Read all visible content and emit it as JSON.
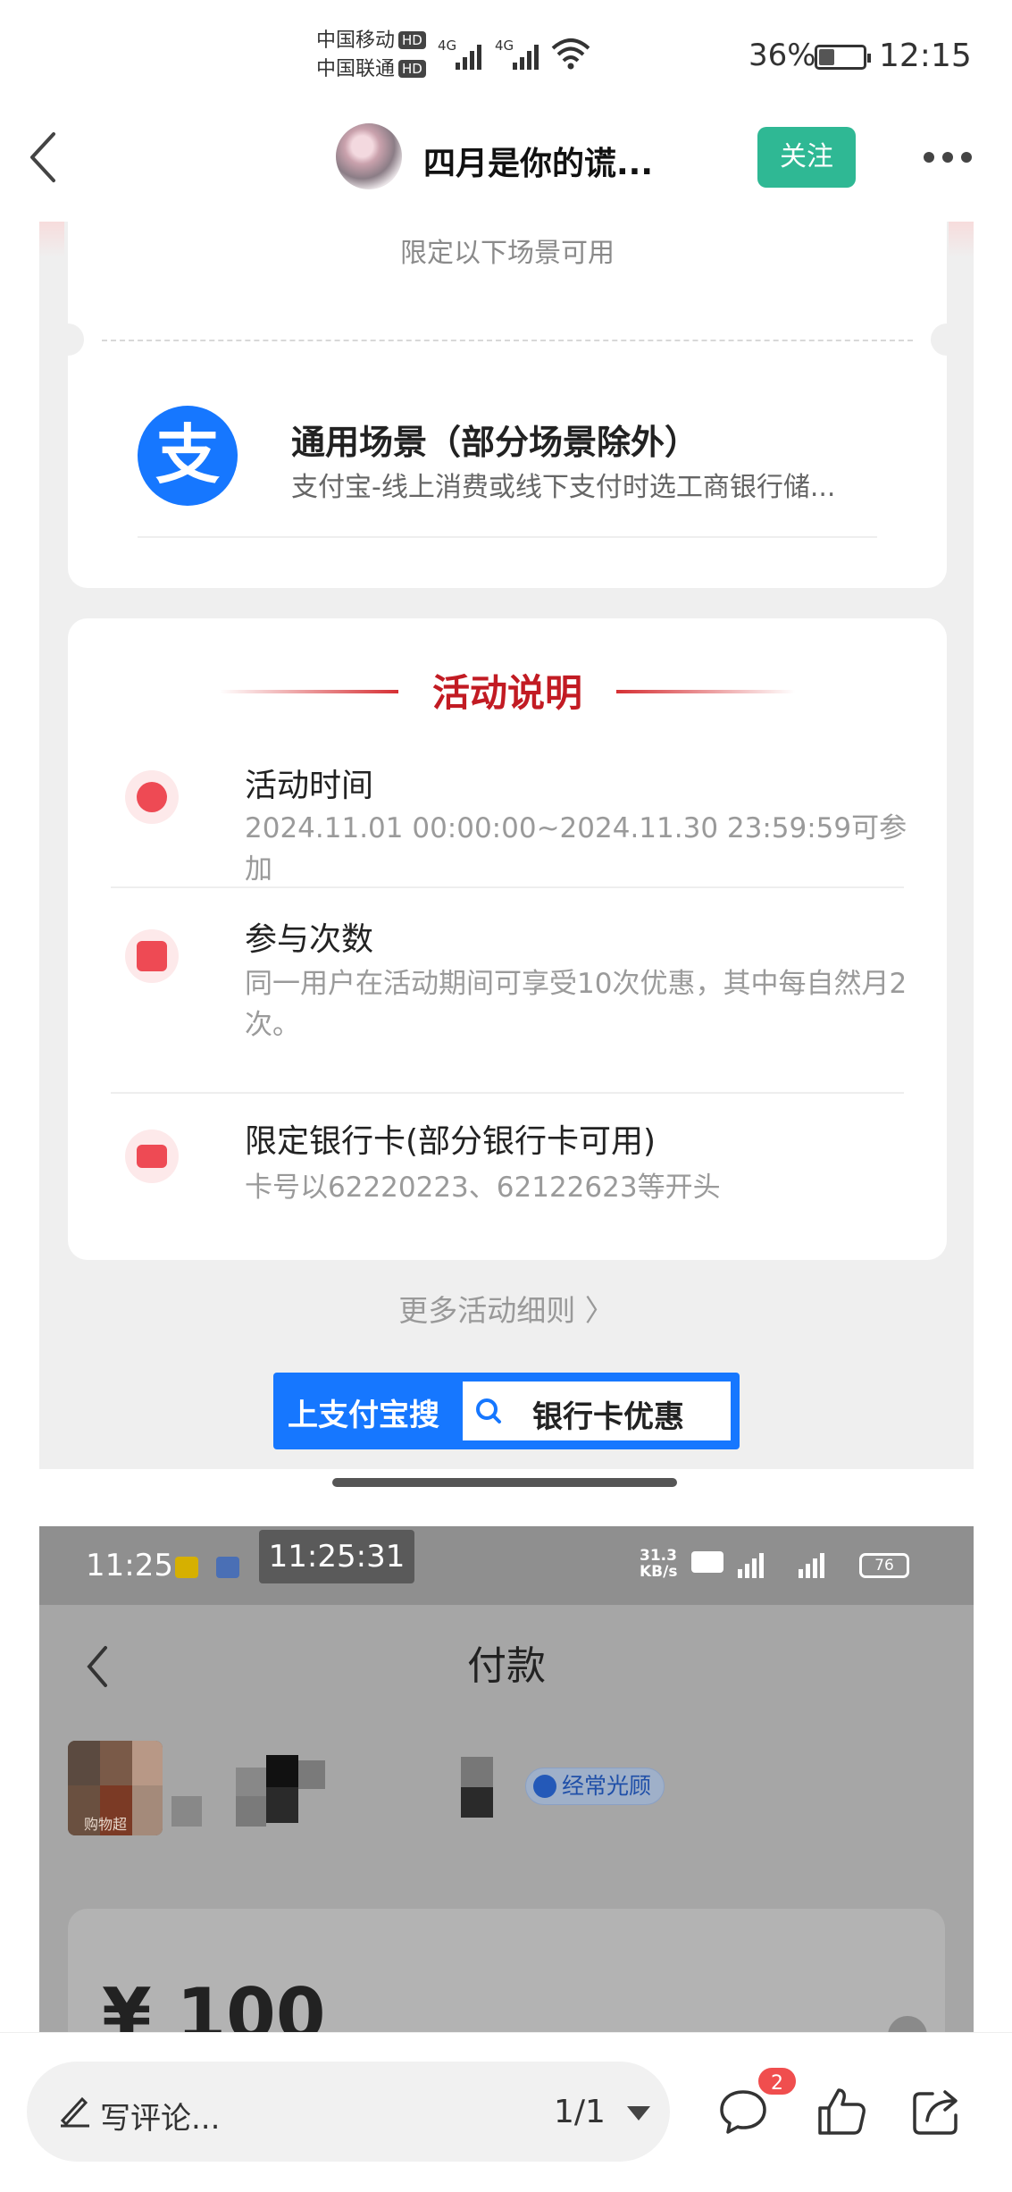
{
  "status_bar": {
    "carrier1": "中国移动",
    "carrier2": "中国联通",
    "hd": "HD",
    "net1": "4G",
    "net2": "4G",
    "battery_pct": "36%",
    "battery_level": 0.36,
    "time": "12:15"
  },
  "header": {
    "author": "四月是你的谎...",
    "follow": "关注"
  },
  "alipay": {
    "scene_note": "限定以下场景可用",
    "logo_char": "支",
    "scene_title": "通用场景（部分场景除外）",
    "scene_desc": "支付宝-线上消费或线下支付时选工商银行储...",
    "activity_title": "活动说明",
    "items": [
      {
        "title": "活动时间",
        "desc": "2024.11.01 00:00:00~2024.11.30 23:59:59可参加",
        "icon": "clock-icon"
      },
      {
        "title": "参与次数",
        "desc": "同一用户在活动期间可享受10次优惠，其中每自然月2次。",
        "icon": "calendar-icon"
      },
      {
        "title": "限定银行卡(部分银行卡可用)",
        "desc": "卡号以62220223、62122623等开头",
        "icon": "bank-card-icon"
      }
    ],
    "more_rules": "更多活动细则 〉",
    "search_label": "上支付宝搜",
    "search_keyword": "银行卡优惠"
  },
  "payment_shot": {
    "time": "11:25",
    "timestamp_chip": "11:25:31",
    "net_speed": "31.3",
    "net_unit": "KB/s",
    "battery": "76",
    "title": "付款",
    "merchant_label": "购物超",
    "frequent_badge": "经常光顾",
    "amount": "¥ 100"
  },
  "bottom_bar": {
    "comment_placeholder": "写评论...",
    "page_indicator": "1/1",
    "comment_count": "2"
  },
  "colors": {
    "follow_green": "#2fb894",
    "alipay_blue": "#1677ff",
    "activity_red": "#c21b23",
    "badge_red": "#f04e4e"
  }
}
